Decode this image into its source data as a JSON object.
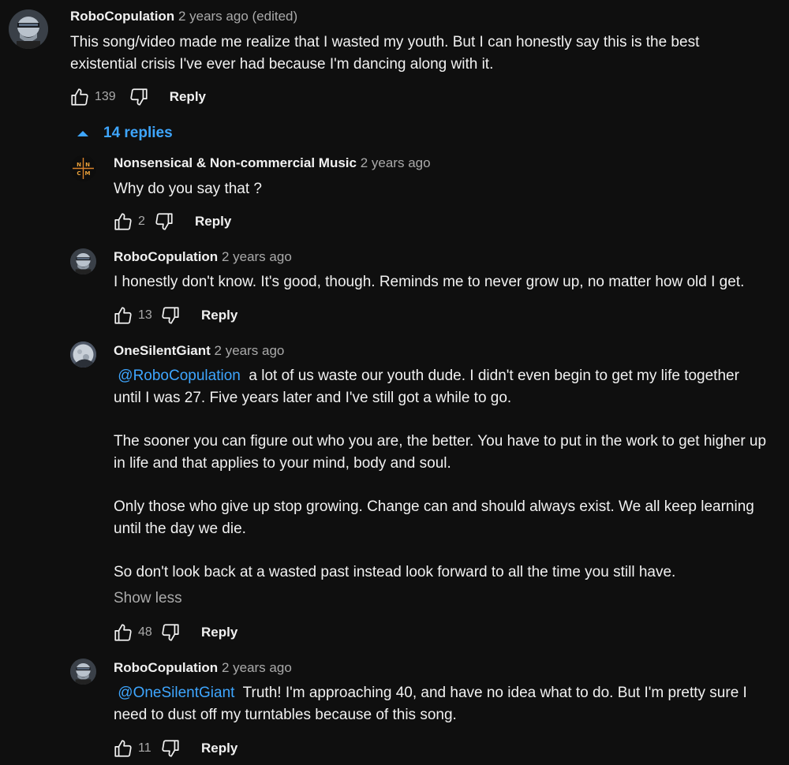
{
  "comments": [
    {
      "author": "RoboCopulation",
      "meta": "2 years ago (edited)",
      "text_lines": [
        "This song/video made me realize that I wasted my youth. But I can honestly say this is the best",
        "existential crisis I've ever had because I'm dancing along with it."
      ],
      "likes": "139",
      "reply_label": "Reply"
    }
  ],
  "replies_toggle": {
    "label": "14 replies"
  },
  "replies": [
    {
      "author": "Nonsensical & Non-commercial Music",
      "meta": "2 years ago",
      "avatar_letters": [
        "N",
        "N",
        "C",
        "M"
      ],
      "text_lines": [
        "Why do you say that ?"
      ],
      "likes": "2",
      "reply_label": "Reply"
    },
    {
      "author": "RoboCopulation",
      "meta": "2 years ago",
      "text_lines": [
        "I honestly don't know. It's good, though. Reminds me to never grow up, no matter how old I get."
      ],
      "likes": "13",
      "reply_label": "Reply"
    },
    {
      "author": "OneSilentGiant",
      "meta": "2 years ago",
      "mention": "@RoboCopulation",
      "first_line_rest": " a lot of us waste our youth dude. I didn't even begin to get my life together",
      "text_lines": [
        "until I was 27. Five years later and I've still got a while to go.",
        "The sooner you can figure out who you are, the better. You have to put in the work to get higher up",
        "in life and that applies to your mind, body and soul.",
        "Only those who give up stop growing. Change can and should always exist. We all keep learning",
        "until the day we die.",
        "So don't look back at a wasted past instead look forward to all the time you still have."
      ],
      "show_less": "Show less",
      "likes": "48",
      "reply_label": "Reply"
    },
    {
      "author": "RoboCopulation",
      "meta": "2 years ago",
      "mention": "@OneSilentGiant",
      "first_line_rest": " Truth! I'm approaching 40, and have no idea what to do. But I'm pretty sure I",
      "text_lines": [
        "need to dust off my turntables because of this song."
      ],
      "likes": "11",
      "reply_label": "Reply"
    }
  ]
}
